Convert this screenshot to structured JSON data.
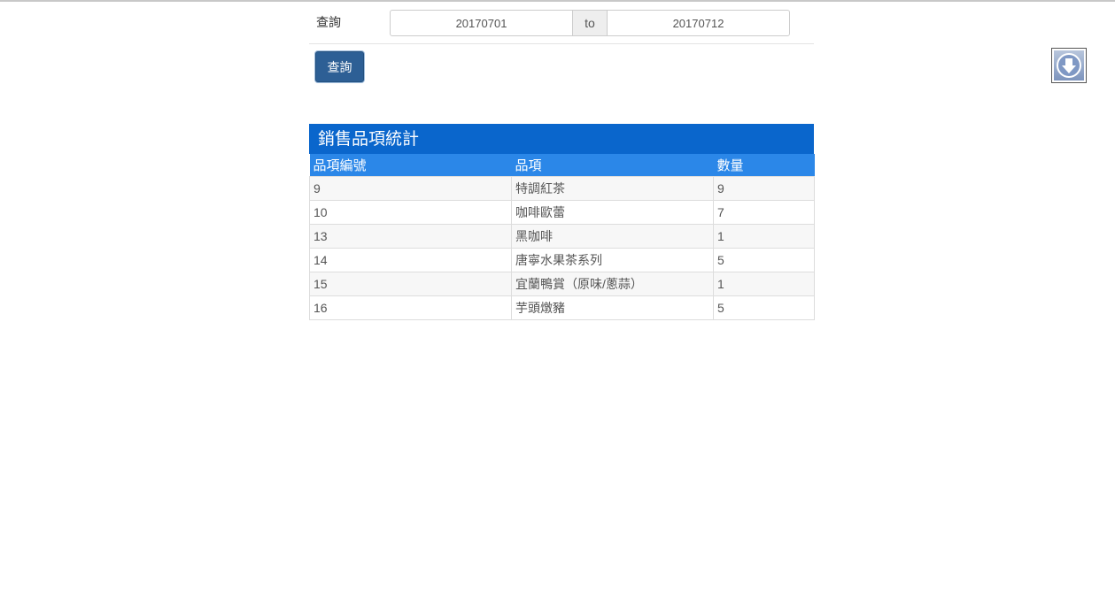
{
  "filter": {
    "label": "查詢",
    "date_from": "20170701",
    "range_word": "to",
    "date_to": "20170712",
    "submit_label": "查詢"
  },
  "download": {
    "icon": "arrow-down-circle-icon"
  },
  "stats": {
    "title": "銷售品項統計",
    "columns": [
      "品項編號",
      "品項",
      "數量"
    ],
    "rows": [
      [
        "9",
        "特調紅茶",
        "9"
      ],
      [
        "10",
        "咖啡歐蕾",
        "7"
      ],
      [
        "13",
        "黑咖啡",
        "1"
      ],
      [
        "14",
        "唐寧水果茶系列",
        "5"
      ],
      [
        "15",
        "宜蘭鴨賞（原味/蔥蒜）",
        "1"
      ],
      [
        "16",
        "芋頭燉豬",
        "5"
      ]
    ]
  },
  "colors": {
    "panel_header": "#0a66cc",
    "table_header": "#2b87e8",
    "button": "#2d5f95"
  }
}
